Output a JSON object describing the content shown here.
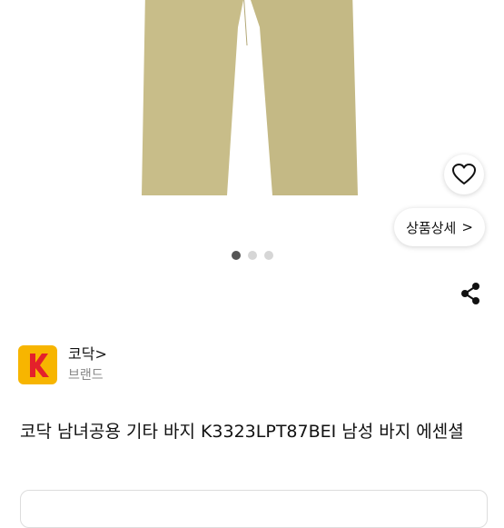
{
  "product": {
    "detail_button_label": "상품상세",
    "detail_button_chevron": ">",
    "carousel": {
      "total": 3,
      "active": 1
    },
    "title": "코닥 남녀공용 기타 바지 K3323LPT87BEI 남성 바지 에센셜"
  },
  "brand": {
    "name": "코닥",
    "chevron": ">",
    "subtitle": "브랜드",
    "logo_text": "KODAK",
    "logo_color": "#f7b500",
    "logo_mark_color": "#e4202b"
  },
  "icons": {
    "like": "heart-icon",
    "share": "share-icon",
    "detail": "chevron-right-icon"
  },
  "colors": {
    "pants": "#c8bd89",
    "active_dot": "#555555",
    "inactive_dot": "#d6d6d6"
  }
}
